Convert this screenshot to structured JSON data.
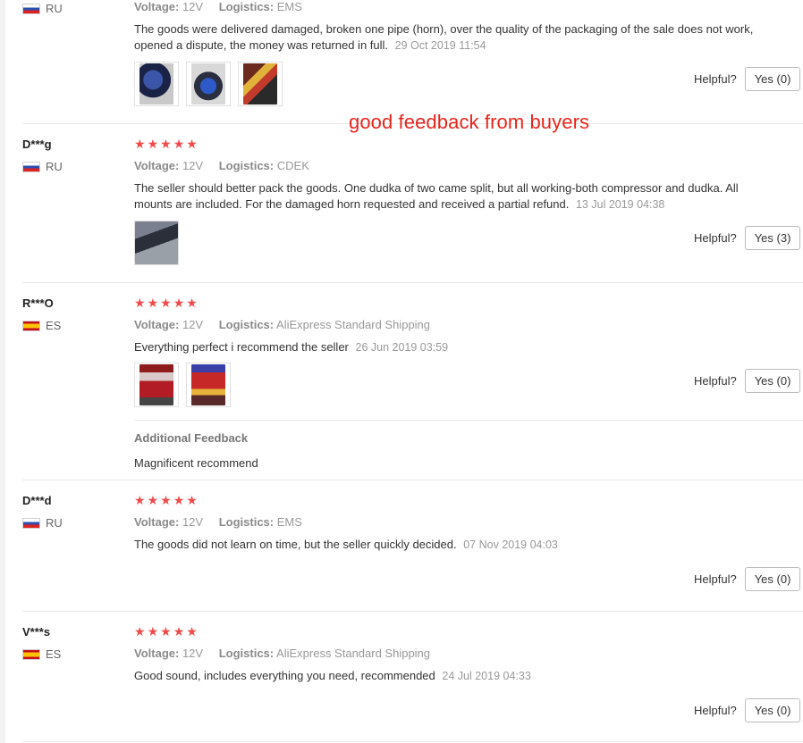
{
  "overlay_caption": "good feedback from buyers",
  "helpful_label": "Helpful?",
  "voltage_key": "Voltage:",
  "logistics_key": "Logistics:",
  "reviews": [
    {
      "buyer": "",
      "country": "RU",
      "voltage": "12V",
      "logistics": "EMS",
      "text": "The goods were delivered damaged, broken one pipe (horn), over the quality of the packaging of the sale does not work, opened a dispute, the money was returned in full.",
      "date": "29 Oct 2019 11:54",
      "yes": "Yes (0)",
      "photos": [
        "horn-photo",
        "horn-photo",
        "horn-photo"
      ]
    },
    {
      "buyer": "D***g",
      "country": "RU",
      "rating": 5,
      "voltage": "12V",
      "logistics": "CDEK",
      "text": "The seller should better pack the goods. One dudka of two came split, but all working-both compressor and dudka. All mounts are included. For the damaged horn requested and received a partial refund.",
      "date": "13 Jul 2019 04:38",
      "yes": "Yes (3)",
      "photos": [
        "kit-photo"
      ]
    },
    {
      "buyer": "R***O",
      "country": "ES",
      "rating": 5,
      "voltage": "12V",
      "logistics": "AliExpress Standard Shipping",
      "text": "Everything perfect i recommend the seller",
      "date": "26 Jun 2019 03:59",
      "yes": "Yes (0)",
      "photos": [
        "package-photo",
        "package-photo"
      ],
      "additional_title": "Additional Feedback",
      "additional_text": "Magnificent recommend"
    },
    {
      "buyer": "D***d",
      "country": "RU",
      "rating": 5,
      "voltage": "12V",
      "logistics": "EMS",
      "text": "The goods did not learn on time, but the seller quickly decided.",
      "date": "07 Nov 2019 04:03",
      "yes": "Yes (0)"
    },
    {
      "buyer": "V***s",
      "country": "ES",
      "rating": 5,
      "voltage": "12V",
      "logistics": "AliExpress Standard Shipping",
      "text": "Good sound, includes everything you need, recommended",
      "date": "24 Jul 2019 04:33",
      "yes": "Yes (0)"
    }
  ],
  "star_color": "#f04a4a",
  "caption_color": "#e8251c"
}
